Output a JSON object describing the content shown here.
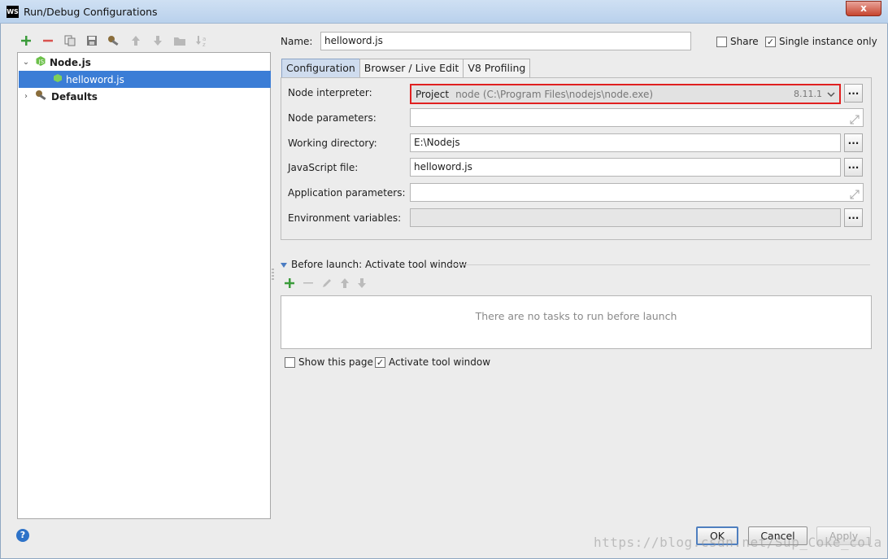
{
  "window": {
    "app_icon_text": "WS",
    "title": "Run/Debug Configurations",
    "close_label": "x"
  },
  "left_toolbar": {
    "icons": [
      "add-icon",
      "remove-icon",
      "copy-icon",
      "save-icon",
      "edit-defaults-icon",
      "move-up-icon",
      "move-down-icon",
      "folder-icon",
      "sort-icon"
    ]
  },
  "tree": {
    "items": [
      {
        "label": "Node.js",
        "expanded": true,
        "bold": true,
        "level": 0,
        "icon": "nodejs-icon"
      },
      {
        "label": "helloword.js",
        "selected": true,
        "level": 1,
        "icon": "nodejs-file-icon"
      },
      {
        "label": "Defaults",
        "expanded": false,
        "bold": true,
        "level": 0,
        "icon": "wrench-icon"
      }
    ]
  },
  "config": {
    "name_label": "Name:",
    "name_value": "helloword.js",
    "share_label": "Share",
    "share_checked": false,
    "single_instance_label": "Single instance only",
    "single_instance_checked": true,
    "tabs": [
      {
        "label": "Configuration",
        "active": true
      },
      {
        "label": "Browser / Live Edit",
        "active": false
      },
      {
        "label": "V8 Profiling",
        "active": false
      }
    ],
    "fields": {
      "node_interpreter_label": "Node interpreter:",
      "node_interpreter_project": "Project",
      "node_interpreter_path": "node (C:\\Program Files\\nodejs\\node.exe)",
      "node_interpreter_version": "8.11.1",
      "node_parameters_label": "Node parameters:",
      "node_parameters_value": "",
      "working_directory_label": "Working directory:",
      "working_directory_value": "E:\\Nodejs",
      "javascript_file_label": "JavaScript file:",
      "javascript_file_value": "helloword.js",
      "application_parameters_label": "Application parameters:",
      "application_parameters_value": "",
      "environment_variables_label": "Environment variables:",
      "environment_variables_value": ""
    },
    "browse_label": "..."
  },
  "before_launch": {
    "header": "Before launch: Activate tool window",
    "empty_text": "There are no tasks to run before launch",
    "show_page_label": "Show this page",
    "show_page_checked": false,
    "activate_tool_label": "Activate tool window",
    "activate_tool_checked": true
  },
  "buttons": {
    "help": "?",
    "ok": "OK",
    "cancel": "Cancel",
    "apply": "Apply"
  },
  "watermark": "https://blog.csdn.net/Sup_Coke_cola",
  "colors": {
    "selection": "#3b7dd6",
    "highlight_border": "#e02020",
    "add_green": "#3a9b3a",
    "remove_red": "#d9534f"
  }
}
